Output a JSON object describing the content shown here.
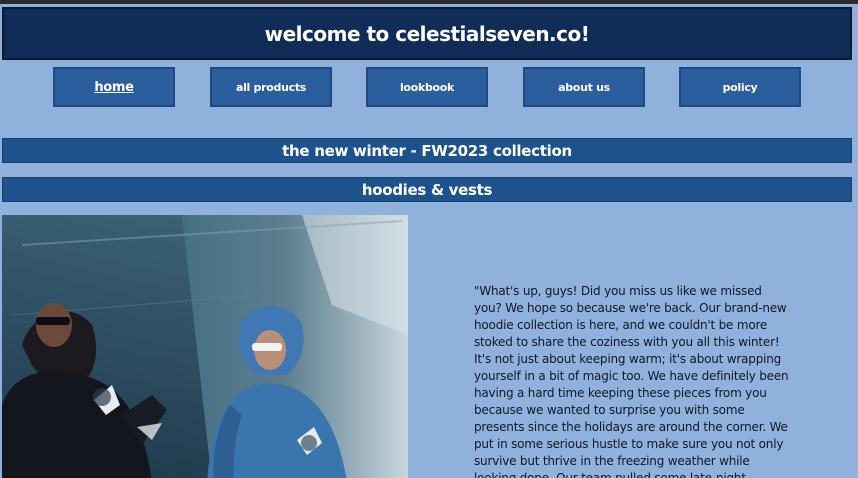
{
  "header": {
    "title": "welcome to celestialseven.co!"
  },
  "nav": {
    "items": [
      {
        "label": "home"
      },
      {
        "label": "all products"
      },
      {
        "label": "lookbook"
      },
      {
        "label": "about us"
      },
      {
        "label": "policy"
      }
    ]
  },
  "banners": {
    "collection": "the new winter - FW2023 collection",
    "category": "hoodies & vests"
  },
  "story": {
    "text": "\"What's up, guys! Did you miss us like we missed you? We hope so because we're back. Our brand-new hoodie collection is here, and we couldn't be more stoked to share the coziness with you all this winter! It's not just about keeping warm; it's about wrapping yourself in a bit of magic too. We have definitely been having a hard time keeping these pieces from you because we wanted to surprise you with some presents since the holidays are around the corner. We put in some serious hustle to make sure you not only survive but thrive in the freezing weather while looking dope. Our team pulled some late-night"
  },
  "colors": {
    "page_bg": "#8fb1dc",
    "header_bg": "#0f2d56",
    "nav_bg": "#2b5e9c",
    "banner_bg": "#1e528c"
  }
}
